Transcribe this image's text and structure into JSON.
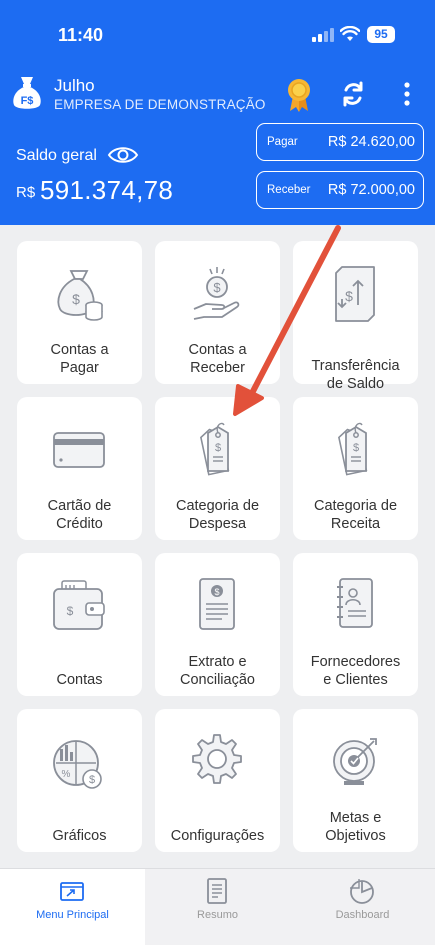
{
  "status_bar": {
    "time": "11:40",
    "battery": "95"
  },
  "header": {
    "month": "Julho",
    "company": "EMPRESA DE DEMONSTRAÇÃO",
    "saldo_label": "Saldo geral",
    "saldo_currency": "R$",
    "saldo_value": "591.374,78",
    "pagar": {
      "label": "Pagar",
      "value": "R$ 24.620,00"
    },
    "receber": {
      "label": "Receber",
      "value": "R$ 72.000,00"
    }
  },
  "menu": [
    {
      "line1": "Contas a",
      "line2": "Pagar",
      "icon": "money-bag-icon"
    },
    {
      "line1": "Contas a",
      "line2": "Receber",
      "icon": "hand-coin-icon"
    },
    {
      "line1": "Transferência",
      "line2": "de Saldo",
      "icon": "transfer-icon"
    },
    {
      "line1": "Cartão de",
      "line2": "Crédito",
      "icon": "credit-card-icon"
    },
    {
      "line1": "Categoria de",
      "line2": "Despesa",
      "icon": "tag-icon"
    },
    {
      "line1": "Categoria de",
      "line2": "Receita",
      "icon": "tag-icon"
    },
    {
      "line1": "Contas",
      "line2": "",
      "icon": "wallet-icon"
    },
    {
      "line1": "Extrato e",
      "line2": "Conciliação",
      "icon": "statement-icon"
    },
    {
      "line1": "Fornecedores",
      "line2": "e Clientes",
      "icon": "contacts-book-icon"
    },
    {
      "line1": "Gráficos",
      "line2": "",
      "icon": "charts-icon"
    },
    {
      "line1": "Configurações",
      "line2": "",
      "icon": "gear-icon"
    },
    {
      "line1": "Metas e",
      "line2": "Objetivos",
      "icon": "target-icon"
    }
  ],
  "tabs": [
    {
      "label": "Menu Principal",
      "icon": "menu-icon",
      "active": true
    },
    {
      "label": "Resumo",
      "icon": "document-icon",
      "active": false
    },
    {
      "label": "Dashboard",
      "icon": "pie-chart-icon",
      "active": false
    }
  ],
  "colors": {
    "primary": "#1d6cf2",
    "arrow": "#e2513a",
    "background": "#eeeff1"
  }
}
